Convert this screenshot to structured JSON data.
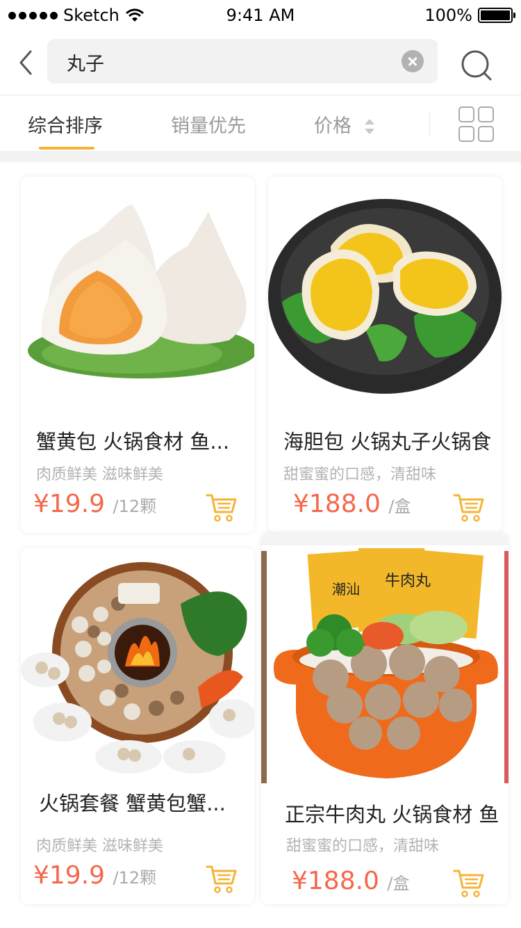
{
  "status_bar": {
    "carrier": "Sketch",
    "time": "9:41 AM",
    "battery": "100%"
  },
  "search": {
    "query": "丸子"
  },
  "sort_tabs": {
    "composite": "综合排序",
    "sales": "销量优先",
    "price": "价格"
  },
  "products": [
    {
      "name": "蟹黄包 火锅食材 鱼...",
      "desc": "肉质鲜美 滋味鲜美",
      "price": "¥19.9",
      "unit": "/12颗"
    },
    {
      "name": "海胆包 火锅丸子火锅食",
      "desc": "甜蜜蜜的口感，清甜味",
      "price": "¥188.0",
      "unit": "/盒"
    },
    {
      "name": "火锅套餐 蟹黄包蟹...",
      "desc": "肉质鲜美 滋味鲜美",
      "price": "¥19.9",
      "unit": "/12颗"
    },
    {
      "name": "正宗牛肉丸 火锅食材 鱼",
      "desc": "甜蜜蜜的口感，清甜味",
      "price": "¥188.0",
      "unit": "/盒"
    }
  ],
  "package_text": {
    "brand_a": "潮汕",
    "brand_b": "牛肉丸"
  },
  "colors": {
    "accent": "#f5b334",
    "price": "#f5674b",
    "cart": "#f5b334"
  }
}
